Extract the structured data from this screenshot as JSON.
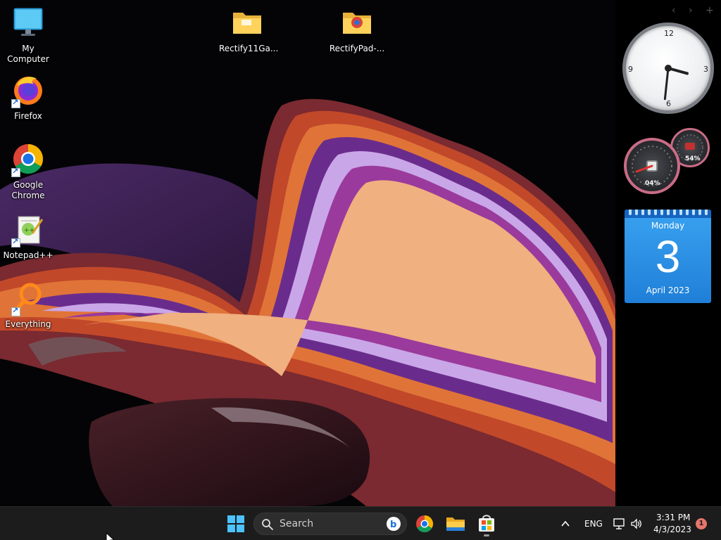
{
  "desktop": {
    "icons": [
      {
        "label": "My Computer",
        "icon": "monitor-icon"
      },
      {
        "label": "Firefox",
        "icon": "firefox-icon"
      },
      {
        "label": "Google\nChrome",
        "icon": "chrome-icon"
      },
      {
        "label": "Notepad++",
        "icon": "notepadpp-icon"
      },
      {
        "label": "Everything",
        "icon": "everything-search-icon"
      },
      {
        "label": "Rectify11Ga...",
        "icon": "folder-icon"
      },
      {
        "label": "RectifyPad-...",
        "icon": "folder-chrome-icon"
      }
    ]
  },
  "gadgets": {
    "sidebar_controls": [
      "‹",
      "›",
      "+"
    ],
    "clock": {
      "numerals": [
        "12",
        "3",
        "6",
        "9"
      ],
      "hour": 3,
      "minute": 31
    },
    "meter": {
      "cpu_label": "04%",
      "memory_label": "54%",
      "cpu_value": 4,
      "memory_value": 54
    },
    "calendar": {
      "weekday": "Monday",
      "day": "3",
      "month_year": "April 2023"
    }
  },
  "taskbar": {
    "search_placeholder": "Search",
    "language": "ENG",
    "time": "3:31 PM",
    "date": "4/3/2023",
    "notification_count": "1"
  },
  "colors": {
    "taskbar_bg": "#1c1c1c",
    "calendar_blue": "#2a8ee6",
    "meter_ring": "#c96c86",
    "notification_badge": "#e8766b"
  }
}
